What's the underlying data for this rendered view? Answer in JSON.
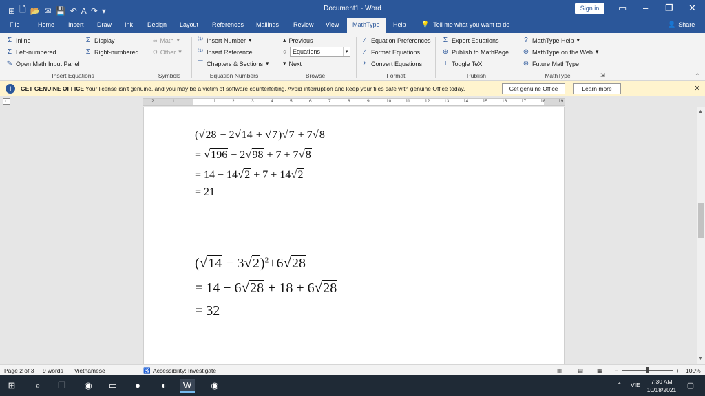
{
  "window": {
    "title": "Document1  -  Word",
    "sign_in": "Sign in"
  },
  "tabs": [
    "File",
    "Home",
    "Insert",
    "Draw",
    "Ink",
    "Design",
    "Layout",
    "References",
    "Mailings",
    "Review",
    "View",
    "MathType",
    "Help"
  ],
  "active_tab": "MathType",
  "tell_me": "Tell me what you want to do",
  "share": "Share",
  "ribbon": {
    "insert_equations": {
      "label": "Insert Equations",
      "inline": "Inline",
      "left_numbered": "Left-numbered",
      "open_math_input": "Open Math Input Panel",
      "display": "Display",
      "right_numbered": "Right-numbered"
    },
    "symbols": {
      "label": "Symbols",
      "math": "Math",
      "other": "Other"
    },
    "equation_numbers": {
      "label": "Equation Numbers",
      "insert_number": "Insert Number",
      "insert_reference": "Insert Reference",
      "chapters_sections": "Chapters & Sections"
    },
    "browse": {
      "label": "Browse",
      "previous": "Previous",
      "combo_value": "Equations",
      "next": "Next"
    },
    "format": {
      "label": "Format",
      "equation_preferences": "Equation Preferences",
      "format_equations": "Format Equations",
      "convert_equations": "Convert Equations"
    },
    "publish": {
      "label": "Publish",
      "export_equations": "Export Equations",
      "publish_to_mathpage": "Publish to MathPage",
      "toggle_tex": "Toggle TeX"
    },
    "mathtype": {
      "label": "MathType",
      "help": "MathType Help",
      "on_the_web": "MathType on the Web",
      "future": "Future MathType"
    }
  },
  "infobar": {
    "heading": "GET GENUINE OFFICE",
    "message": "Your license isn't genuine, and you may be a victim of software counterfeiting. Avoid interruption and keep your files safe with genuine Office today.",
    "get_genuine": "Get genuine Office",
    "learn_more": "Learn more"
  },
  "ruler_numbers": [
    "2",
    "1",
    "1",
    "2",
    "3",
    "4",
    "5",
    "6",
    "7",
    "8",
    "9",
    "10",
    "11",
    "12",
    "13",
    "14",
    "15",
    "16",
    "17",
    "18",
    "19"
  ],
  "equations": {
    "group1": {
      "l1": {
        "a": "(",
        "r1": "28",
        "b": " − 2",
        "r2": "14",
        "c": " + ",
        "r3": "7",
        "d": ")",
        "r4": "7",
        "e": " + 7",
        "r5": "8"
      },
      "l2": {
        "a": "= ",
        "r1": "196",
        "b": " − 2",
        "r2": "98",
        "c": " + 7 + 7",
        "r3": "8"
      },
      "l3": {
        "a": "= 14 − 14",
        "r1": "2",
        "b": " + 7 + 14",
        "r2": "2"
      },
      "l4": "= 21"
    },
    "group2": {
      "l1": {
        "a": "(",
        "r1": "14",
        "b": " − 3",
        "r2": "2",
        "c": ")",
        "sup": "2",
        "d": "+6",
        "r3": "28"
      },
      "l2": {
        "a": "= 14 − 6",
        "r1": "28",
        "b": " + 18 + 6",
        "r2": "28"
      },
      "l3": "= 32"
    }
  },
  "status": {
    "page": "Page 2 of 3",
    "words": "9 words",
    "language": "Vietnamese",
    "accessibility": "Accessibility: Investigate",
    "zoom": "100%"
  },
  "taskbar": {
    "lang": "VIE",
    "time": "7:30 AM",
    "date": "10/18/2021"
  },
  "colors": {
    "accent": "#2b579a",
    "infobar_bg": "#fff4ce",
    "taskbar_bg": "#1f2a36"
  }
}
